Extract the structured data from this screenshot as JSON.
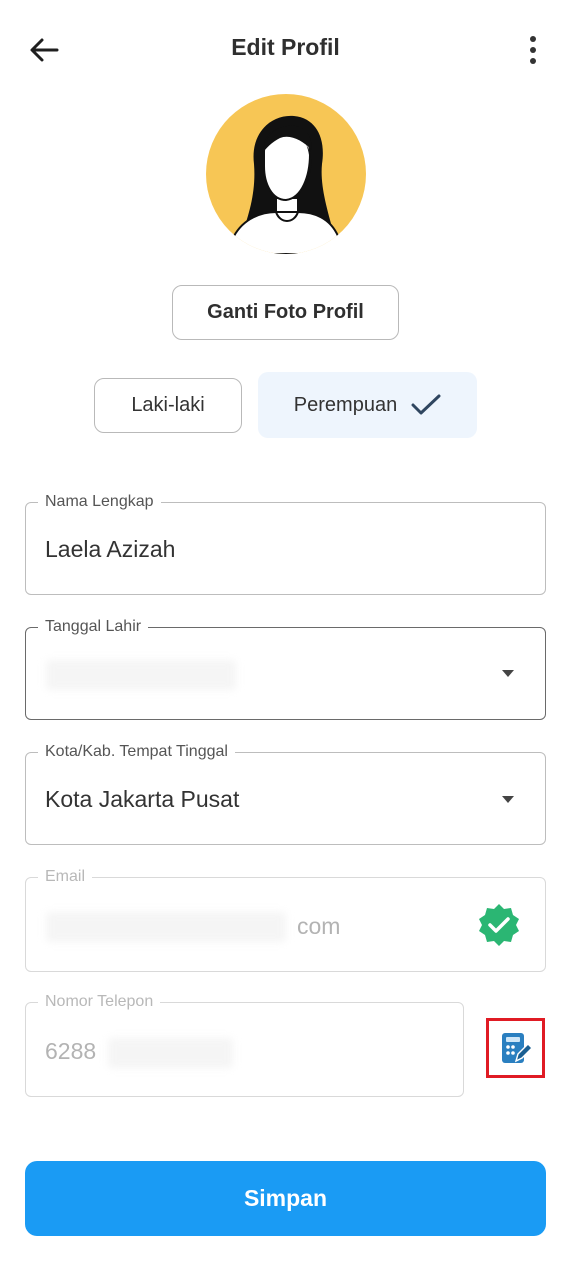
{
  "header": {
    "title": "Edit Profil",
    "back_icon": "arrow-left-icon",
    "menu_icon": "more-vertical-icon"
  },
  "profile": {
    "change_photo_label": "Ganti Foto Profil",
    "avatar_bg_color": "#f7c655"
  },
  "gender": {
    "male_label": "Laki-laki",
    "female_label": "Perempuan",
    "selected": "Perempuan",
    "selected_bg_color": "#eef5fd"
  },
  "form": {
    "name": {
      "label": "Nama Lengkap",
      "value": "Laela Azizah"
    },
    "birthdate": {
      "label": "Tanggal Lahir"
    },
    "city": {
      "label": "Kota/Kab. Tempat Tinggal",
      "value": "Kota Jakarta Pusat"
    },
    "email": {
      "label": "Email",
      "value_visible": "com",
      "verified": true,
      "verified_color": "#2bb673"
    },
    "phone": {
      "label": "Nomor Telepon",
      "value_visible": "6288",
      "edit_icon": "phone-edit-icon"
    }
  },
  "actions": {
    "save_label": "Simpan",
    "save_color": "#1a9bf4"
  }
}
